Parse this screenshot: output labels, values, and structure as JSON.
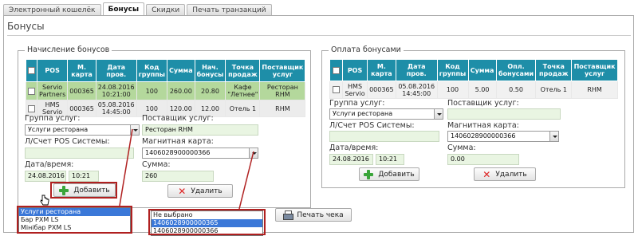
{
  "tabs": [
    "Электронный кошелёк",
    "Бонусы",
    "Скидки",
    "Печать транзакций"
  ],
  "page_title": "Бонусы",
  "left": {
    "legend": "Начисление бонусов",
    "headers": [
      "",
      "POS",
      "М. карта",
      "Дата пров.",
      "Код группы",
      "Сумма",
      "Нач. бонусы",
      "Точка продаж",
      "Поставщик услуг"
    ],
    "rows": [
      {
        "pos": "Servio Partners",
        "card": "000365",
        "date": "24.08.2016 10:21:00",
        "code": "100",
        "sum": "260.00",
        "bonus": "20.80",
        "point": "Кафе \"Летнее\"",
        "provider": "Ресторан RHM"
      },
      {
        "pos": "HMS Servio",
        "card": "000365",
        "date": "05.08.2016 14:45:00",
        "code": "100",
        "sum": "120.00",
        "bonus": "12.00",
        "point": "Отель 1",
        "provider": "RHM"
      }
    ],
    "group_label": "Группа услуг:",
    "group_value": "Услуги ресторана",
    "provider_label": "Поставщик услуг:",
    "provider_value": "Ресторан RHM",
    "account_label": "Л/Счет POS Системы:",
    "account_value": "",
    "card_label": "Магнитная карта:",
    "card_value": "1406028900000366",
    "datetime_label": "Дата/время:",
    "date_value": "24.08.2016",
    "time_value": "10:21",
    "sum_label": "Сумма:",
    "sum_value": "260",
    "add_label": "Добавить",
    "delete_label": "Удалить",
    "group_options": [
      "Услуги ресторана",
      "Бар РХМ LS",
      "Мінібар РХМ LS"
    ],
    "card_options": [
      "Не выбрано",
      "1406028900000365",
      "1406028900000366"
    ]
  },
  "right": {
    "legend": "Оплата бонусами",
    "headers": [
      "",
      "POS",
      "М. карта",
      "Дата пров.",
      "Код группы",
      "Сумма",
      "Опл. бонусами",
      "Точка продаж",
      "Поставщик услуг"
    ],
    "rows": [
      {
        "pos": "HMS Servio",
        "card": "000365",
        "date": "05.08.2016 14:45:00",
        "code": "100",
        "sum": "5.00",
        "bonus": "0.50",
        "point": "Отель 1",
        "provider": "RHM"
      }
    ],
    "group_label": "Группа услуг:",
    "group_value": "Услуги ресторана",
    "provider_label": "Поставщик услуг:",
    "provider_value": "",
    "account_label": "Л/Счет POS Системы:",
    "account_value": "",
    "card_label": "Магнитная карта:",
    "card_value": "1406028900000366",
    "datetime_label": "Дата/время:",
    "date_value": "24.08.2016",
    "time_value": "10:21",
    "sum_label": "Сумма:",
    "sum_value": "0.00",
    "add_label": "Добавить",
    "delete_label": "Удалить"
  },
  "print_label": "Печать чека",
  "colors": {
    "header": "#1e8ea8",
    "selected_row": "#b4d89c",
    "input_bg": "#e9f5e2",
    "highlight": "#b02020",
    "list_selection": "#3b78d8"
  }
}
